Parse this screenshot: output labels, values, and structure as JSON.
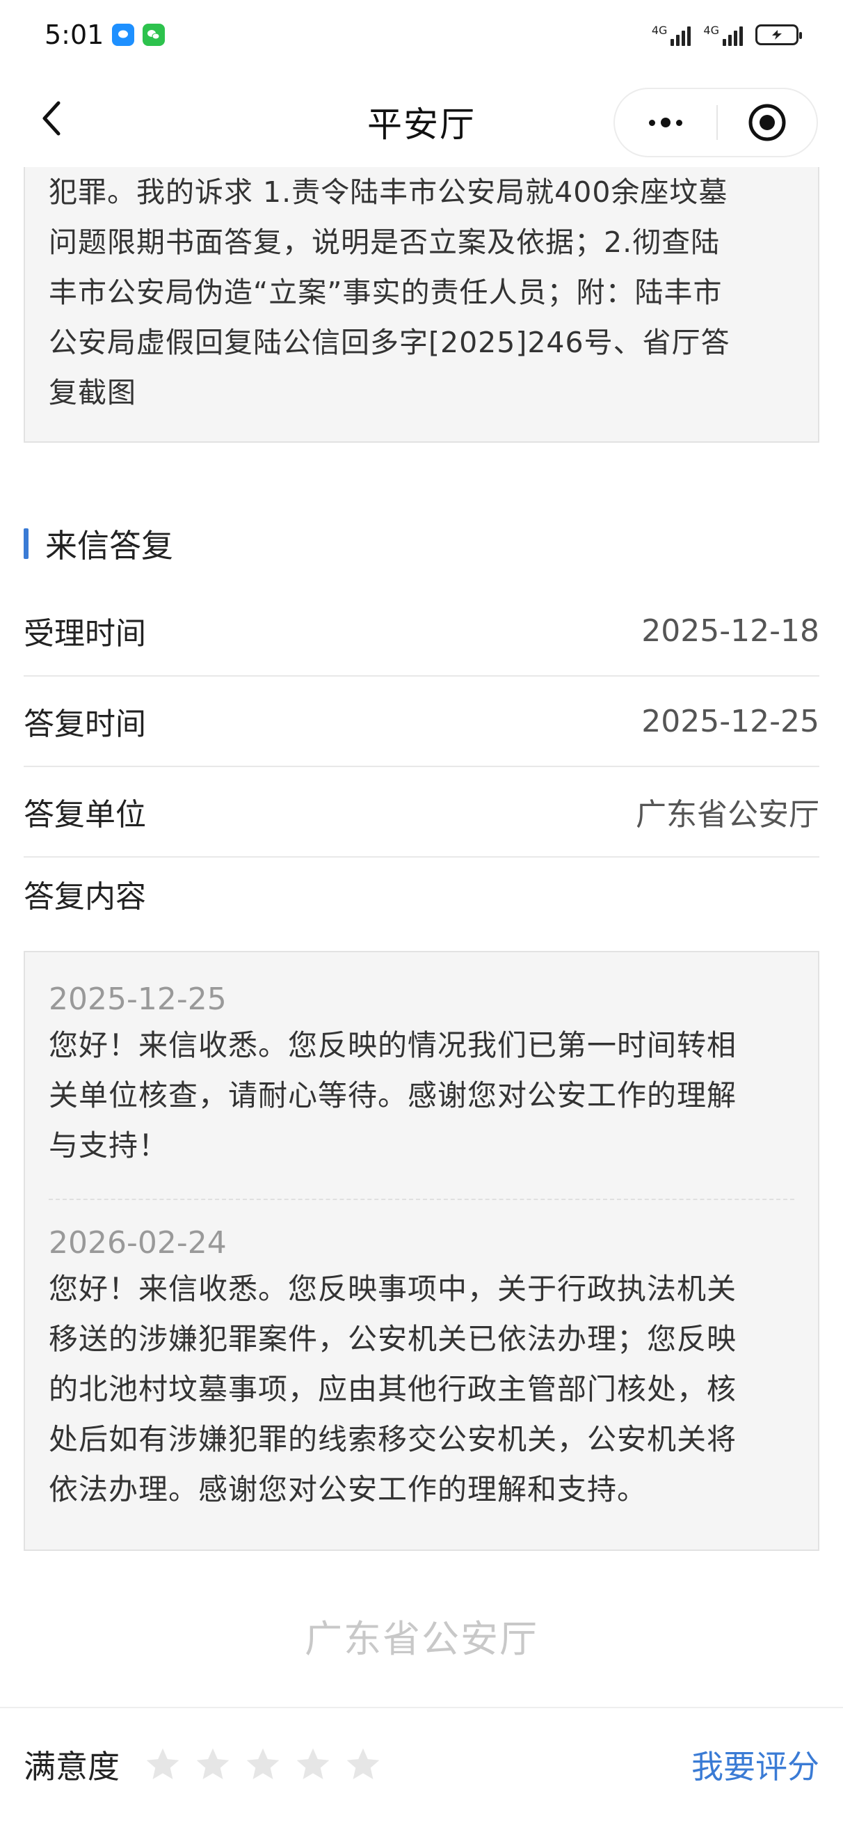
{
  "status_bar": {
    "time": "5:01",
    "signal1_label": "4G",
    "signal2_label": "4G"
  },
  "nav": {
    "title": "平安厅"
  },
  "letter": {
    "lines": [
      "犯罪。我的诉求 1.责令陆丰市公安局就400余座坟墓",
      "问题限期书面答复，说明是否立案及依据；2.彻查陆",
      "丰市公安局伪造“立案”事实的责任人员；附：陆丰市",
      "公安局虚假回复陆公信回多字[2025]246号、省厅答",
      "复截图"
    ]
  },
  "reply_section": {
    "title": "来信答复",
    "rows": [
      {
        "label": "受理时间",
        "value": "2025-12-18"
      },
      {
        "label": "答复时间",
        "value": "2025-12-25"
      },
      {
        "label": "答复单位",
        "value": "广东省公安厅"
      }
    ],
    "content_label": "答复内容",
    "entries": [
      {
        "date": "2025-12-25",
        "lines": [
          "您好！来信收悉。您反映的情况我们已第一时间转相",
          "关单位核查，请耐心等待。感谢您对公安工作的理解",
          "与支持！"
        ]
      },
      {
        "date": "2026-02-24",
        "lines": [
          "您好！来信收悉。您反映事项中，关于行政执法机关",
          "移送的涉嫌犯罪案件，公安机关已依法办理；您反映",
          "的北池村坟墓事项，应由其他行政主管部门核处，核",
          "处后如有涉嫌犯罪的线索移交公安机关，公安机关将",
          "依法办理。感谢您对公安工作的理解和支持。"
        ]
      }
    ]
  },
  "footer": {
    "watermark": "广东省公安厅"
  },
  "bottom_bar": {
    "satisfaction_label": "满意度",
    "rating": 0,
    "max_rating": 5,
    "rate_button": "我要评分"
  },
  "colors": {
    "accent": "#3a7bd5",
    "star_empty": "#e6e6e6"
  }
}
